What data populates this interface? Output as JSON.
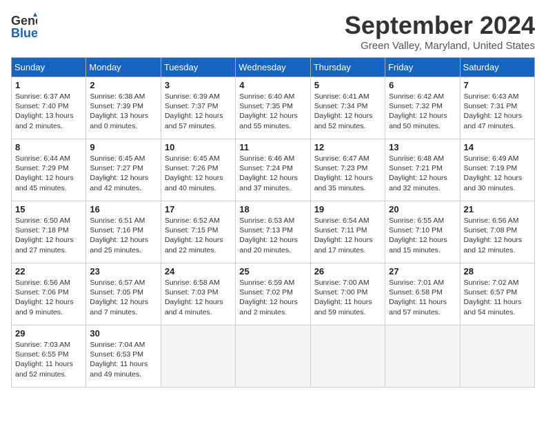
{
  "header": {
    "logo_general": "General",
    "logo_blue": "Blue",
    "month_title": "September 2024",
    "subtitle": "Green Valley, Maryland, United States"
  },
  "weekdays": [
    "Sunday",
    "Monday",
    "Tuesday",
    "Wednesday",
    "Thursday",
    "Friday",
    "Saturday"
  ],
  "weeks": [
    [
      {
        "day": "1",
        "sunrise": "6:37 AM",
        "sunset": "7:40 PM",
        "daylight": "13 hours and 2 minutes."
      },
      {
        "day": "2",
        "sunrise": "6:38 AM",
        "sunset": "7:39 PM",
        "daylight": "13 hours and 0 minutes."
      },
      {
        "day": "3",
        "sunrise": "6:39 AM",
        "sunset": "7:37 PM",
        "daylight": "12 hours and 57 minutes."
      },
      {
        "day": "4",
        "sunrise": "6:40 AM",
        "sunset": "7:35 PM",
        "daylight": "12 hours and 55 minutes."
      },
      {
        "day": "5",
        "sunrise": "6:41 AM",
        "sunset": "7:34 PM",
        "daylight": "12 hours and 52 minutes."
      },
      {
        "day": "6",
        "sunrise": "6:42 AM",
        "sunset": "7:32 PM",
        "daylight": "12 hours and 50 minutes."
      },
      {
        "day": "7",
        "sunrise": "6:43 AM",
        "sunset": "7:31 PM",
        "daylight": "12 hours and 47 minutes."
      }
    ],
    [
      {
        "day": "8",
        "sunrise": "6:44 AM",
        "sunset": "7:29 PM",
        "daylight": "12 hours and 45 minutes."
      },
      {
        "day": "9",
        "sunrise": "6:45 AM",
        "sunset": "7:27 PM",
        "daylight": "12 hours and 42 minutes."
      },
      {
        "day": "10",
        "sunrise": "6:45 AM",
        "sunset": "7:26 PM",
        "daylight": "12 hours and 40 minutes."
      },
      {
        "day": "11",
        "sunrise": "6:46 AM",
        "sunset": "7:24 PM",
        "daylight": "12 hours and 37 minutes."
      },
      {
        "day": "12",
        "sunrise": "6:47 AM",
        "sunset": "7:23 PM",
        "daylight": "12 hours and 35 minutes."
      },
      {
        "day": "13",
        "sunrise": "6:48 AM",
        "sunset": "7:21 PM",
        "daylight": "12 hours and 32 minutes."
      },
      {
        "day": "14",
        "sunrise": "6:49 AM",
        "sunset": "7:19 PM",
        "daylight": "12 hours and 30 minutes."
      }
    ],
    [
      {
        "day": "15",
        "sunrise": "6:50 AM",
        "sunset": "7:18 PM",
        "daylight": "12 hours and 27 minutes."
      },
      {
        "day": "16",
        "sunrise": "6:51 AM",
        "sunset": "7:16 PM",
        "daylight": "12 hours and 25 minutes."
      },
      {
        "day": "17",
        "sunrise": "6:52 AM",
        "sunset": "7:15 PM",
        "daylight": "12 hours and 22 minutes."
      },
      {
        "day": "18",
        "sunrise": "6:53 AM",
        "sunset": "7:13 PM",
        "daylight": "12 hours and 20 minutes."
      },
      {
        "day": "19",
        "sunrise": "6:54 AM",
        "sunset": "7:11 PM",
        "daylight": "12 hours and 17 minutes."
      },
      {
        "day": "20",
        "sunrise": "6:55 AM",
        "sunset": "7:10 PM",
        "daylight": "12 hours and 15 minutes."
      },
      {
        "day": "21",
        "sunrise": "6:56 AM",
        "sunset": "7:08 PM",
        "daylight": "12 hours and 12 minutes."
      }
    ],
    [
      {
        "day": "22",
        "sunrise": "6:56 AM",
        "sunset": "7:06 PM",
        "daylight": "12 hours and 9 minutes."
      },
      {
        "day": "23",
        "sunrise": "6:57 AM",
        "sunset": "7:05 PM",
        "daylight": "12 hours and 7 minutes."
      },
      {
        "day": "24",
        "sunrise": "6:58 AM",
        "sunset": "7:03 PM",
        "daylight": "12 hours and 4 minutes."
      },
      {
        "day": "25",
        "sunrise": "6:59 AM",
        "sunset": "7:02 PM",
        "daylight": "12 hours and 2 minutes."
      },
      {
        "day": "26",
        "sunrise": "7:00 AM",
        "sunset": "7:00 PM",
        "daylight": "11 hours and 59 minutes."
      },
      {
        "day": "27",
        "sunrise": "7:01 AM",
        "sunset": "6:58 PM",
        "daylight": "11 hours and 57 minutes."
      },
      {
        "day": "28",
        "sunrise": "7:02 AM",
        "sunset": "6:57 PM",
        "daylight": "11 hours and 54 minutes."
      }
    ],
    [
      {
        "day": "29",
        "sunrise": "7:03 AM",
        "sunset": "6:55 PM",
        "daylight": "11 hours and 52 minutes."
      },
      {
        "day": "30",
        "sunrise": "7:04 AM",
        "sunset": "6:53 PM",
        "daylight": "11 hours and 49 minutes."
      },
      null,
      null,
      null,
      null,
      null
    ]
  ]
}
